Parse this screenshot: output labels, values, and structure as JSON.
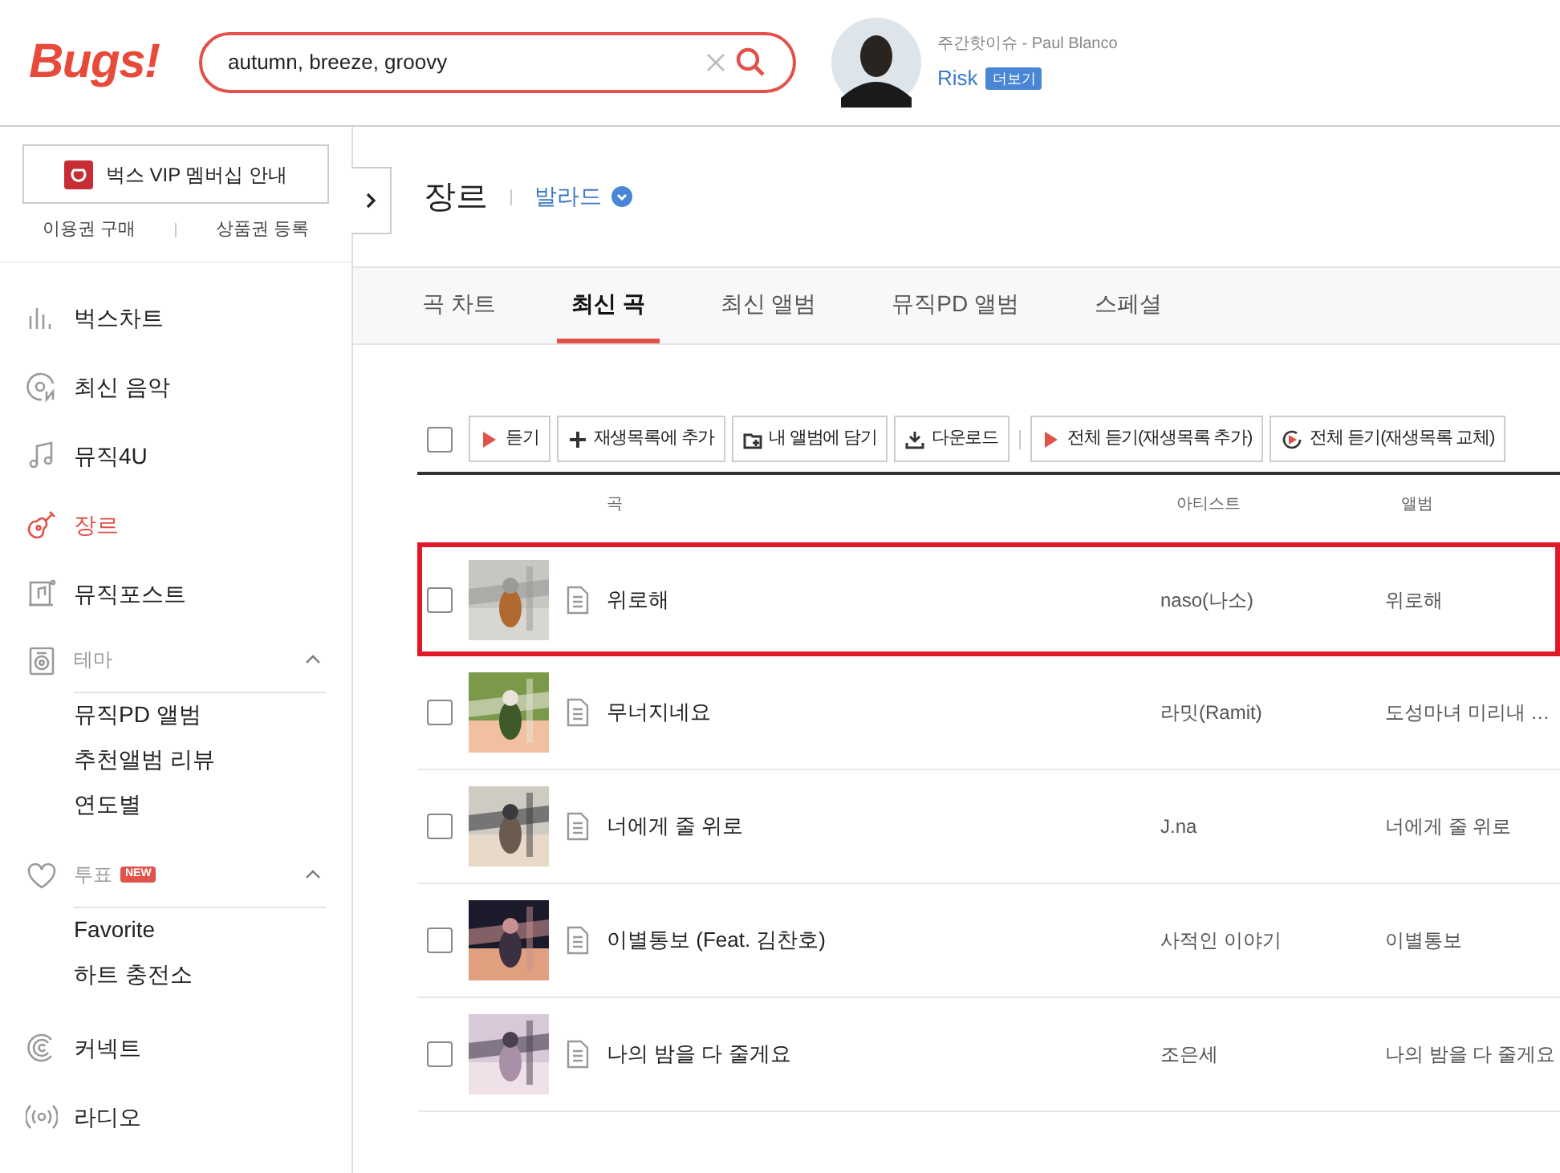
{
  "logo": "Bugs!",
  "search": {
    "value": "autumn, breeze, groovy"
  },
  "hot_issue": {
    "label": "주간핫이슈 - Paul Blanco",
    "title": "Risk",
    "more": "더보기"
  },
  "vip": {
    "label": "벅스 VIP 멤버십 안내",
    "links": [
      "이용권 구매",
      "상품권 등록"
    ]
  },
  "sidebar": {
    "items": [
      {
        "kind": "link",
        "label": "벅스차트",
        "selected": false
      },
      {
        "kind": "link",
        "label": "최신 음악",
        "selected": false
      },
      {
        "kind": "link",
        "label": "뮤직4U",
        "selected": false
      },
      {
        "kind": "link",
        "label": "장르",
        "selected": true
      },
      {
        "kind": "link",
        "label": "뮤직포스트",
        "selected": false
      },
      {
        "kind": "group",
        "label": "테마",
        "expanded": true,
        "children": [
          {
            "label": "뮤직PD 앨범"
          },
          {
            "label": "추천앨범 리뷰"
          },
          {
            "label": "연도별"
          }
        ]
      },
      {
        "kind": "group",
        "label": "투표",
        "badge": "NEW",
        "expanded": true,
        "children": [
          {
            "label": "Favorite"
          },
          {
            "label": "하트 충전소"
          }
        ]
      },
      {
        "kind": "link",
        "label": "커넥트",
        "selected": false
      },
      {
        "kind": "link",
        "label": "라디오",
        "selected": false
      }
    ]
  },
  "page": {
    "title": "장르",
    "genre": "발라드"
  },
  "tabs": [
    {
      "label": "곡 차트",
      "selected": false
    },
    {
      "label": "최신 곡",
      "selected": true
    },
    {
      "label": "최신 앨범",
      "selected": false
    },
    {
      "label": "뮤직PD 앨범",
      "selected": false
    },
    {
      "label": "스페셜",
      "selected": false
    }
  ],
  "select_all": {
    "checked": false
  },
  "toolbar": [
    {
      "kind": "play",
      "label": "듣기",
      "separated": false
    },
    {
      "kind": "add",
      "label": "재생목록에 추가",
      "separated": false
    },
    {
      "kind": "album",
      "label": "내 앨범에 담기",
      "separated": false
    },
    {
      "kind": "download",
      "label": "다운로드",
      "separated": false
    },
    {
      "kind": "play",
      "label": "전체 듣기(재생목록 추가)",
      "separated": true
    },
    {
      "kind": "replace",
      "label": "전체 듣기(재생목록 교체)",
      "separated": false
    }
  ],
  "table": {
    "columns": [
      "곡",
      "아티스트",
      "앨범"
    ],
    "rows": [
      {
        "title": "위로해",
        "artist": "naso(나소)",
        "album": "위로해",
        "highlighted": true,
        "checked": false
      },
      {
        "title": "무너지네요",
        "artist": "라밋(Ramit)",
        "album": "도성마녀 미리내 …",
        "highlighted": false,
        "checked": false
      },
      {
        "title": "너에게 줄 위로",
        "artist": "J.na",
        "album": "너에게 줄 위로",
        "highlighted": false,
        "checked": false
      },
      {
        "title": "이별통보 (Feat. 김찬호)",
        "artist": "사적인 이야기",
        "album": "이별통보",
        "highlighted": false,
        "checked": false
      },
      {
        "title": "나의 밤을 다 줄게요",
        "artist": "조은세",
        "album": "나의 밤을 다 줄게요",
        "highlighted": false,
        "checked": false
      }
    ]
  }
}
